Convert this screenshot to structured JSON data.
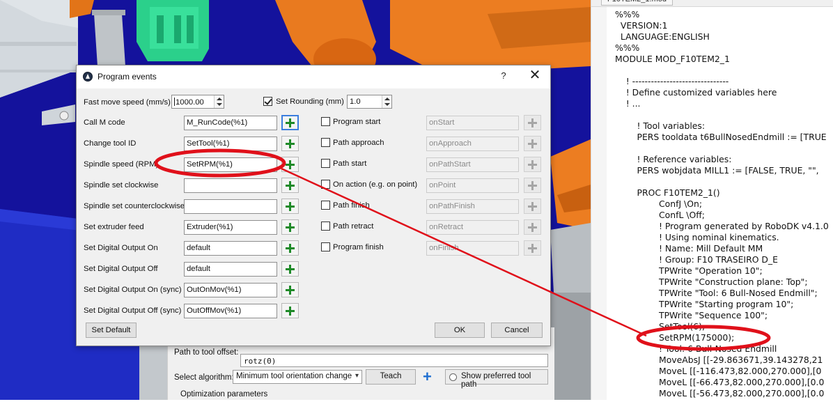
{
  "dialog": {
    "title": "Program events",
    "help_label": "?",
    "close_label": "✕",
    "fast_move_label": "Fast move speed (mm/s)",
    "fast_move_value": "1000.00",
    "set_rounding_label": "Set Rounding (mm)",
    "set_rounding_checked": true,
    "rounding_value": "1.0",
    "left_rows": [
      {
        "label": "Call M code",
        "value": "M_RunCode(%1)"
      },
      {
        "label": "Change tool ID",
        "value": "SetTool(%1)"
      },
      {
        "label": "Spindle speed (RPM)",
        "value": "SetRPM(%1)"
      },
      {
        "label": "Spindle set clockwise",
        "value": ""
      },
      {
        "label": "Spindle set counterclockwise",
        "value": ""
      },
      {
        "label": "Set extruder feed",
        "value": "Extruder(%1)"
      },
      {
        "label": "Set Digital Output On",
        "value": "default"
      },
      {
        "label": "Set Digital Output Off",
        "value": "default"
      },
      {
        "label": "Set Digital Output On (sync)",
        "value": "OutOnMov(%1)"
      },
      {
        "label": "Set Digital Output Off (sync)",
        "value": "OutOffMov(%1)"
      }
    ],
    "right_rows": [
      {
        "label": "Program start",
        "value": "onStart"
      },
      {
        "label": "Path approach",
        "value": "onApproach"
      },
      {
        "label": "Path start",
        "value": "onPathStart"
      },
      {
        "label": "On action  (e.g. on point)",
        "value": "onPoint"
      },
      {
        "label": "Path finish",
        "value": "onPathFinish"
      },
      {
        "label": "Path retract",
        "value": "onRetract"
      },
      {
        "label": "Program finish",
        "value": "onFinish"
      }
    ],
    "set_default_label": "Set Default",
    "ok_label": "OK",
    "cancel_label": "Cancel"
  },
  "under_panel": {
    "tool_offset_label": "Path to tool offset:",
    "tool_offset_value": "rotz(0)",
    "algorithm_label": "Select algorithm:",
    "algorithm_value": "Minimum tool orientation change",
    "teach_label": "Teach",
    "show_pref_label": "Show preferred tool path",
    "optimization_label": "Optimization parameters"
  },
  "editor": {
    "tab_label": "F10TEM2_1.mod",
    "lines": [
      "%%%",
      "  VERSION:1",
      "  LANGUAGE:ENGLISH",
      "%%%",
      "MODULE MOD_F10TEM2_1",
      "",
      "    ! -------------------------------",
      "    ! Define customized variables here",
      "    ! ...",
      "",
      "        ! Tool variables:",
      "        PERS tooldata t6BullNosedEndmill := [TRUE",
      "",
      "        ! Reference variables:",
      "        PERS wobjdata MILL1 := [FALSE, TRUE, \"\",",
      "",
      "        PROC F10TEM2_1()",
      "                ConfJ \\On;",
      "                ConfL \\Off;",
      "                ! Program generated by RoboDK v4.1.0",
      "                ! Using nominal kinematics.",
      "                ! Name: Mill Default MM",
      "                ! Group: F10 TRASEIRO D_E",
      "                TPWrite \"Operation 10\";",
      "                TPWrite \"Construction plane: Top\";",
      "                TPWrite \"Tool: 6 Bull-Nosed Endmill\";",
      "                TPWrite \"Starting program 10\";",
      "                TPWrite \"Sequence 100\";",
      "                SetTool(6);",
      "                SetRPM(175000);",
      "                ! Tool: 6 Bull-Nosed Endmill",
      "                MoveAbsJ [[-29.863671,39.143278,21",
      "                MoveL [[-116.473,82.000,270.000],[0",
      "                MoveL [[-66.473,82.000,270.000],[0.0",
      "                MoveL [[-56.473,82.000,270.000],[0.0"
    ]
  },
  "colors": {
    "annotation": "#e0101a",
    "robot_orange": "#e8771e",
    "scene_blue": "#13129a",
    "fixture_green": "#2fd08a"
  }
}
